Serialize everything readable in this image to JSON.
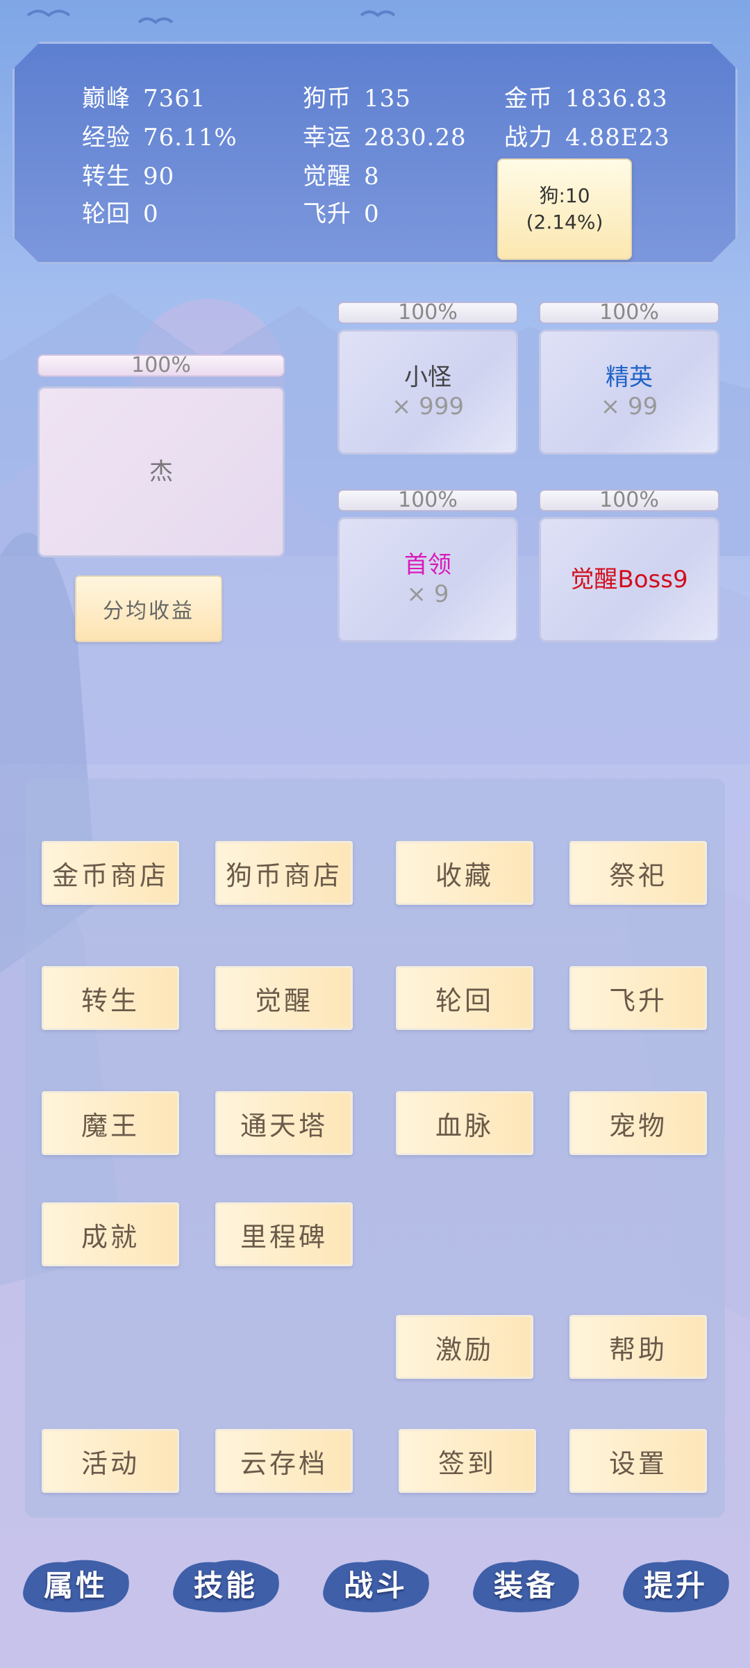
{
  "stats": [
    {
      "label": "巅峰",
      "value": "7361"
    },
    {
      "label": "狗币",
      "value": "135"
    },
    {
      "label": "金币",
      "value": "1836.83"
    },
    {
      "label": "经验",
      "value": "76.11%"
    },
    {
      "label": "幸运",
      "value": "2830.28"
    },
    {
      "label": "战力",
      "value": "4.88E23"
    },
    {
      "label": "转生",
      "value": "90"
    },
    {
      "label": "觉醒",
      "value": "8"
    },
    {
      "label": "轮回",
      "value": "0"
    },
    {
      "label": "飞升",
      "value": "0"
    }
  ],
  "dog_box": {
    "line1": "狗:10",
    "line2": "(2.14%)"
  },
  "player": {
    "percent": "100%",
    "name": "杰"
  },
  "share_button": "分均收益",
  "enemies": [
    {
      "percent": "100%",
      "name": "小怪",
      "count": "× 999",
      "color": "#444444"
    },
    {
      "percent": "100%",
      "name": "精英",
      "count": "× 99",
      "color": "#1f63c8"
    },
    {
      "percent": "100%",
      "name": "首领",
      "count": "× 9",
      "color": "#d81ab9"
    },
    {
      "percent": "100%",
      "name": "觉醒Boss9",
      "count": "",
      "color": "#d20f1c"
    }
  ],
  "menu": {
    "gold_shop": "金币商店",
    "dog_shop": "狗币商店",
    "collection": "收藏",
    "sacrifice": "祭祀",
    "rebirth": "转生",
    "awaken": "觉醒",
    "reincarnation": "轮回",
    "ascend": "飞升",
    "demon_king": "魔王",
    "sky_tower": "通天塔",
    "bloodline": "血脉",
    "pet": "宠物",
    "achievement": "成就",
    "milestone": "里程碑",
    "incentive": "激励",
    "help": "帮助",
    "event": "活动",
    "cloud_save": "云存档",
    "sign_in": "签到",
    "settings": "设置"
  },
  "nav": [
    "属性",
    "技能",
    "战斗",
    "装备",
    "提升"
  ]
}
